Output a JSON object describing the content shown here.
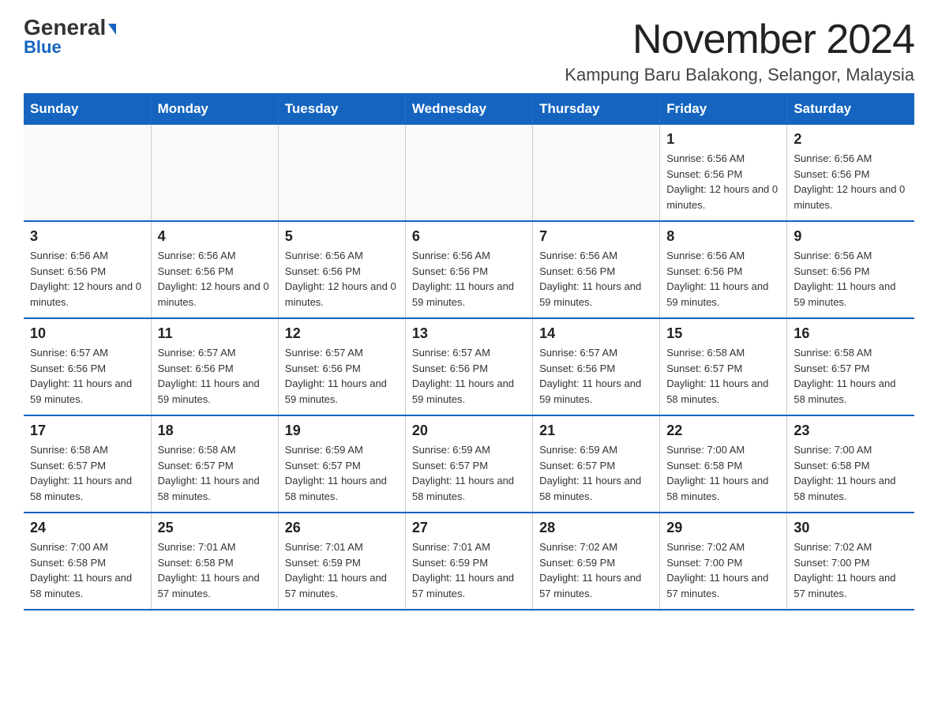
{
  "logo": {
    "general": "General",
    "blue": "Blue",
    "arrow": "▶"
  },
  "header": {
    "month_title": "November 2024",
    "location": "Kampung Baru Balakong, Selangor, Malaysia"
  },
  "days_of_week": [
    "Sunday",
    "Monday",
    "Tuesday",
    "Wednesday",
    "Thursday",
    "Friday",
    "Saturday"
  ],
  "weeks": [
    [
      {
        "day": "",
        "info": ""
      },
      {
        "day": "",
        "info": ""
      },
      {
        "day": "",
        "info": ""
      },
      {
        "day": "",
        "info": ""
      },
      {
        "day": "",
        "info": ""
      },
      {
        "day": "1",
        "info": "Sunrise: 6:56 AM\nSunset: 6:56 PM\nDaylight: 12 hours and 0 minutes."
      },
      {
        "day": "2",
        "info": "Sunrise: 6:56 AM\nSunset: 6:56 PM\nDaylight: 12 hours and 0 minutes."
      }
    ],
    [
      {
        "day": "3",
        "info": "Sunrise: 6:56 AM\nSunset: 6:56 PM\nDaylight: 12 hours and 0 minutes."
      },
      {
        "day": "4",
        "info": "Sunrise: 6:56 AM\nSunset: 6:56 PM\nDaylight: 12 hours and 0 minutes."
      },
      {
        "day": "5",
        "info": "Sunrise: 6:56 AM\nSunset: 6:56 PM\nDaylight: 12 hours and 0 minutes."
      },
      {
        "day": "6",
        "info": "Sunrise: 6:56 AM\nSunset: 6:56 PM\nDaylight: 11 hours and 59 minutes."
      },
      {
        "day": "7",
        "info": "Sunrise: 6:56 AM\nSunset: 6:56 PM\nDaylight: 11 hours and 59 minutes."
      },
      {
        "day": "8",
        "info": "Sunrise: 6:56 AM\nSunset: 6:56 PM\nDaylight: 11 hours and 59 minutes."
      },
      {
        "day": "9",
        "info": "Sunrise: 6:56 AM\nSunset: 6:56 PM\nDaylight: 11 hours and 59 minutes."
      }
    ],
    [
      {
        "day": "10",
        "info": "Sunrise: 6:57 AM\nSunset: 6:56 PM\nDaylight: 11 hours and 59 minutes."
      },
      {
        "day": "11",
        "info": "Sunrise: 6:57 AM\nSunset: 6:56 PM\nDaylight: 11 hours and 59 minutes."
      },
      {
        "day": "12",
        "info": "Sunrise: 6:57 AM\nSunset: 6:56 PM\nDaylight: 11 hours and 59 minutes."
      },
      {
        "day": "13",
        "info": "Sunrise: 6:57 AM\nSunset: 6:56 PM\nDaylight: 11 hours and 59 minutes."
      },
      {
        "day": "14",
        "info": "Sunrise: 6:57 AM\nSunset: 6:56 PM\nDaylight: 11 hours and 59 minutes."
      },
      {
        "day": "15",
        "info": "Sunrise: 6:58 AM\nSunset: 6:57 PM\nDaylight: 11 hours and 58 minutes."
      },
      {
        "day": "16",
        "info": "Sunrise: 6:58 AM\nSunset: 6:57 PM\nDaylight: 11 hours and 58 minutes."
      }
    ],
    [
      {
        "day": "17",
        "info": "Sunrise: 6:58 AM\nSunset: 6:57 PM\nDaylight: 11 hours and 58 minutes."
      },
      {
        "day": "18",
        "info": "Sunrise: 6:58 AM\nSunset: 6:57 PM\nDaylight: 11 hours and 58 minutes."
      },
      {
        "day": "19",
        "info": "Sunrise: 6:59 AM\nSunset: 6:57 PM\nDaylight: 11 hours and 58 minutes."
      },
      {
        "day": "20",
        "info": "Sunrise: 6:59 AM\nSunset: 6:57 PM\nDaylight: 11 hours and 58 minutes."
      },
      {
        "day": "21",
        "info": "Sunrise: 6:59 AM\nSunset: 6:57 PM\nDaylight: 11 hours and 58 minutes."
      },
      {
        "day": "22",
        "info": "Sunrise: 7:00 AM\nSunset: 6:58 PM\nDaylight: 11 hours and 58 minutes."
      },
      {
        "day": "23",
        "info": "Sunrise: 7:00 AM\nSunset: 6:58 PM\nDaylight: 11 hours and 58 minutes."
      }
    ],
    [
      {
        "day": "24",
        "info": "Sunrise: 7:00 AM\nSunset: 6:58 PM\nDaylight: 11 hours and 58 minutes."
      },
      {
        "day": "25",
        "info": "Sunrise: 7:01 AM\nSunset: 6:58 PM\nDaylight: 11 hours and 57 minutes."
      },
      {
        "day": "26",
        "info": "Sunrise: 7:01 AM\nSunset: 6:59 PM\nDaylight: 11 hours and 57 minutes."
      },
      {
        "day": "27",
        "info": "Sunrise: 7:01 AM\nSunset: 6:59 PM\nDaylight: 11 hours and 57 minutes."
      },
      {
        "day": "28",
        "info": "Sunrise: 7:02 AM\nSunset: 6:59 PM\nDaylight: 11 hours and 57 minutes."
      },
      {
        "day": "29",
        "info": "Sunrise: 7:02 AM\nSunset: 7:00 PM\nDaylight: 11 hours and 57 minutes."
      },
      {
        "day": "30",
        "info": "Sunrise: 7:02 AM\nSunset: 7:00 PM\nDaylight: 11 hours and 57 minutes."
      }
    ]
  ]
}
